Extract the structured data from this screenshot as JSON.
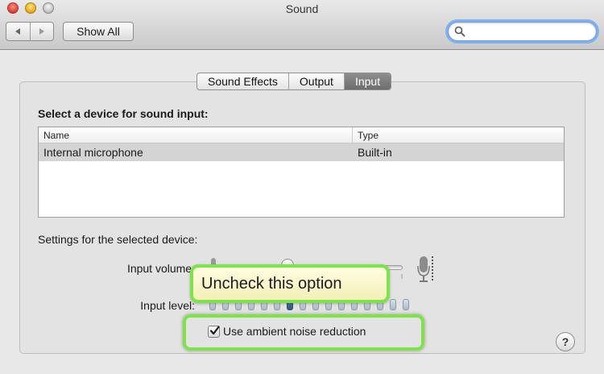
{
  "window": {
    "title": "Sound"
  },
  "toolbar": {
    "back_icon": "back-arrow-icon",
    "forward_icon": "forward-arrow-icon",
    "show_all_label": "Show All",
    "search_value": "",
    "search_placeholder": ""
  },
  "tabs": [
    {
      "label": "Sound Effects",
      "active": false
    },
    {
      "label": "Output",
      "active": false
    },
    {
      "label": "Input",
      "active": true
    }
  ],
  "input": {
    "section_title": "Select a device for sound input:",
    "table": {
      "columns": [
        "Name",
        "Type"
      ],
      "rows": [
        {
          "name": "Internal microphone",
          "type": "Built-in",
          "selected": true
        }
      ]
    },
    "settings_label": "Settings for the selected device:",
    "input_volume_label": "Input volume:",
    "input_level_label": "Input level:",
    "ambient_noise_label": "Use ambient noise reduction",
    "ambient_noise_checked": true,
    "help_label": "?"
  },
  "annotation": {
    "callout_text": "Uncheck this option",
    "highlight_color": "#7ee24a"
  },
  "colors": {
    "selected_tab": "#7d7d7d",
    "selected_row": "#d4d4d4",
    "search_focus": "#7fb0f0"
  }
}
